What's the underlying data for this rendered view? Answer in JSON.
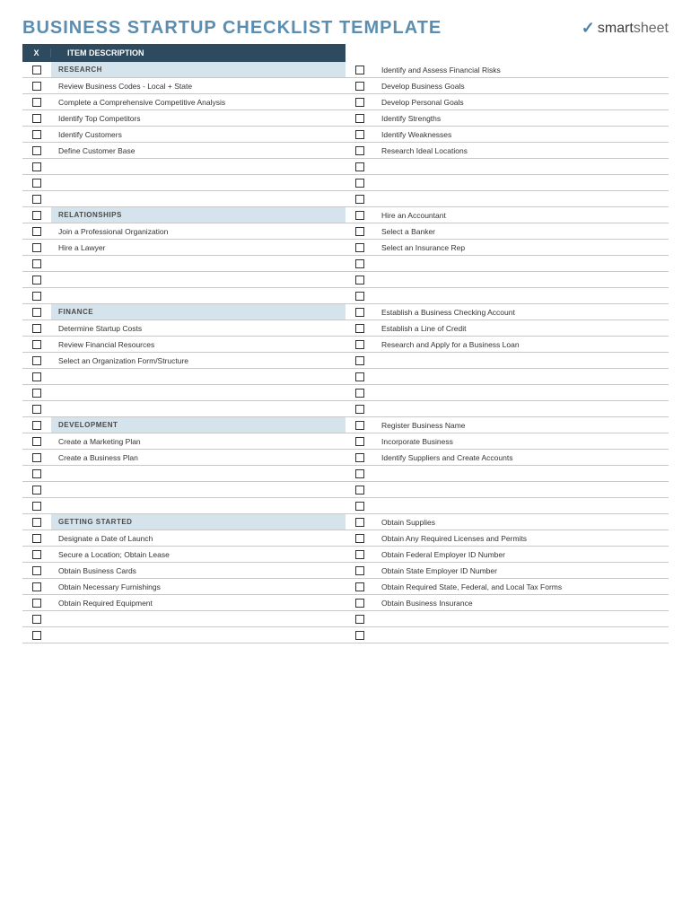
{
  "title": "BUSINESS STARTUP CHECKLIST TEMPLATE",
  "brand": {
    "smart": "smart",
    "sheet": "sheet"
  },
  "header": {
    "x": "X",
    "desc": "ITEM DESCRIPTION"
  },
  "sections": [
    {
      "name": "RESEARCH",
      "left": [
        "Review Business Codes - Local + State",
        "Complete a Comprehensive Competitive Analysis",
        "Identify Top Competitors",
        "Identify Customers",
        "Define Customer Base",
        "",
        "",
        ""
      ],
      "right": [
        "Identify and Assess Financial Risks",
        "Develop Business Goals",
        "Develop Personal Goals",
        "Identify Strengths",
        "Identify Weaknesses",
        "Research Ideal Locations",
        "",
        "",
        ""
      ]
    },
    {
      "name": "RELATIONSHIPS",
      "left": [
        "Join a Professional Organization",
        "Hire a Lawyer",
        "",
        "",
        ""
      ],
      "right": [
        "Hire an Accountant",
        "Select a Banker",
        "Select an Insurance Rep",
        "",
        "",
        ""
      ]
    },
    {
      "name": "FINANCE",
      "left": [
        "Determine Startup Costs",
        "Review Financial Resources",
        "Select an Organization Form/Structure",
        "",
        "",
        ""
      ],
      "right": [
        "Establish a Business Checking Account",
        "Establish a Line of Credit",
        "Research and Apply for a Business Loan",
        "",
        "",
        "",
        ""
      ]
    },
    {
      "name": "DEVELOPMENT",
      "left": [
        "Create a Marketing Plan",
        "Create a Business Plan",
        "",
        "",
        ""
      ],
      "right": [
        "Register Business Name",
        "Incorporate Business",
        "Identify Suppliers and Create Accounts",
        "",
        "",
        ""
      ]
    },
    {
      "name": "GETTING STARTED",
      "left": [
        "Designate a Date of Launch",
        "Secure a Location;  Obtain Lease",
        "Obtain Business Cards",
        "Obtain Necessary Furnishings",
        "Obtain Required Equipment",
        "",
        ""
      ],
      "right": [
        "Obtain Supplies",
        "Obtain Any Required Licenses and Permits",
        "Obtain Federal Employer ID Number",
        "Obtain State Employer ID Number",
        "Obtain Required State, Federal, and Local Tax Forms",
        "Obtain Business Insurance",
        "",
        ""
      ]
    }
  ]
}
